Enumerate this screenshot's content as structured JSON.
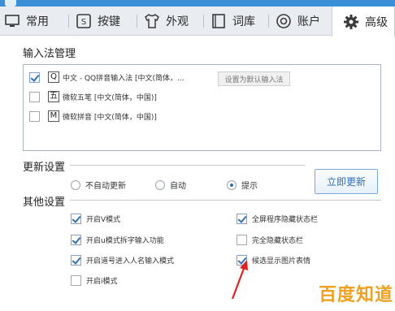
{
  "window": {
    "title": ""
  },
  "tabs": [
    {
      "label": "常用",
      "icon": "monitor-icon"
    },
    {
      "label": "按键",
      "icon": "keyboard-shortcut-icon"
    },
    {
      "label": "外观",
      "icon": "shirt-icon"
    },
    {
      "label": "词库",
      "icon": "book-icon"
    },
    {
      "label": "账户",
      "icon": "account-icon"
    },
    {
      "label": "高级",
      "icon": "gear-icon"
    }
  ],
  "active_tab": "高级",
  "ime_management": {
    "title": "输入法管理",
    "items": [
      {
        "icon_glyph": "Q",
        "label": "中文 - QQ拼音输入法 [中文(简体，...",
        "checked": true
      },
      {
        "icon_glyph": "五",
        "label": "微软五笔 [中文(简体，中国)]",
        "checked": false
      },
      {
        "icon_glyph": "M",
        "label": "微软拼音 [中文(简体，中国)]",
        "checked": false
      }
    ],
    "set_default_button": "设置为默认输入法"
  },
  "update_settings": {
    "title": "更新设置",
    "options": [
      {
        "label": "不自动更新",
        "selected": false
      },
      {
        "label": "自动",
        "selected": false
      },
      {
        "label": "提示",
        "selected": true
      }
    ],
    "update_now_button": "立即更新"
  },
  "other_settings": {
    "title": "其他设置",
    "left": [
      {
        "label": "开启V模式",
        "checked": true
      },
      {
        "label": "开启u模式拆字输入功能",
        "checked": true
      },
      {
        "label": "开启道号进入人名输入模式",
        "checked": true
      },
      {
        "label": "开启i模式",
        "checked": false
      }
    ],
    "right": [
      {
        "label": "全屏程序隐藏状态栏",
        "checked": true
      },
      {
        "label": "完全隐藏状态栏",
        "checked": false
      },
      {
        "label": "候选显示图片表情",
        "checked": true
      }
    ]
  },
  "colors": {
    "accent": "#3b8fd6",
    "annotation_arrow": "#e02020",
    "watermark": "#f0a020"
  },
  "watermark": "百度知道"
}
